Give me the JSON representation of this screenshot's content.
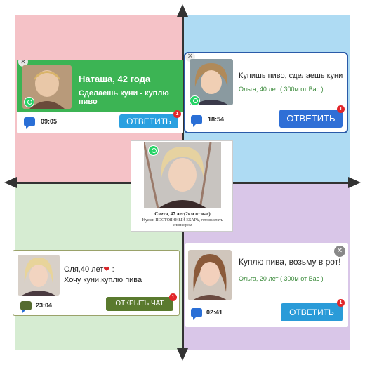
{
  "cards": {
    "top_left": {
      "name": "Наташа, 42 года",
      "message": "Сделаешь куни - куплю пиво",
      "time": "09:05",
      "button": "ОТВЕТИТЬ",
      "badge": "1"
    },
    "top_right": {
      "message": "Купишь пиво, сделаешь куни",
      "info": "Ольга, 40 лет ( 300м от Вас )",
      "time": "18:54",
      "button": "ОТВЕТИТЬ",
      "badge": "1"
    },
    "center": {
      "name": "Света, 47 лет(2км от вас)",
      "message": "Нужен ПОСТОЯННЫЙ ЕБАРЬ, готова стать спонсором"
    },
    "bottom_left": {
      "name": "Оля,40 лет",
      "heart": "❤",
      "colon": ":",
      "message": "Хочу куни,куплю пива",
      "time": "23:04",
      "button": "ОТКРЫТЬ ЧАТ",
      "badge": "1"
    },
    "bottom_right": {
      "message": "Куплю пива, возьму в рот!",
      "info": "Ольга, 20 лет ( 300м от Вас )",
      "time": "02:41",
      "button": "ОТВЕТИТЬ",
      "badge": "1",
      "close": "✕"
    }
  },
  "colors": {
    "quadrant_tl": "#f5c2c7",
    "quadrant_tr": "#aedbf3",
    "quadrant_bl": "#d6ecd2",
    "quadrant_br": "#d9c6e8",
    "green_card": "#3cb454",
    "blue_button": "#2f6fd6",
    "olive_button": "#5a7a2e",
    "teal_button": "#2a9bd8",
    "badge": "#e3262a"
  }
}
